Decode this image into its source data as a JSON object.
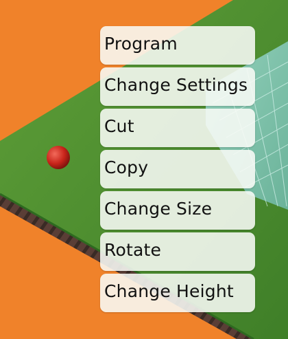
{
  "menu": {
    "items": [
      {
        "label": "Program"
      },
      {
        "label": "Change Settings"
      },
      {
        "label": "Cut"
      },
      {
        "label": "Copy"
      },
      {
        "label": "Change Size"
      },
      {
        "label": "Rotate"
      },
      {
        "label": "Change Height"
      }
    ]
  },
  "colors": {
    "background": "#F0822A",
    "grass": "#4A8A2E",
    "grass_light": "#5E9E38",
    "wall": "#5A3E36",
    "wall_stripe": "#3A2A24",
    "tile": "#7FC8B8",
    "ball": "#C8241A",
    "menu_bg": "#F8FAF6",
    "menu_text": "#111111"
  },
  "scene": {
    "ball_icon": "red-ball-icon"
  }
}
